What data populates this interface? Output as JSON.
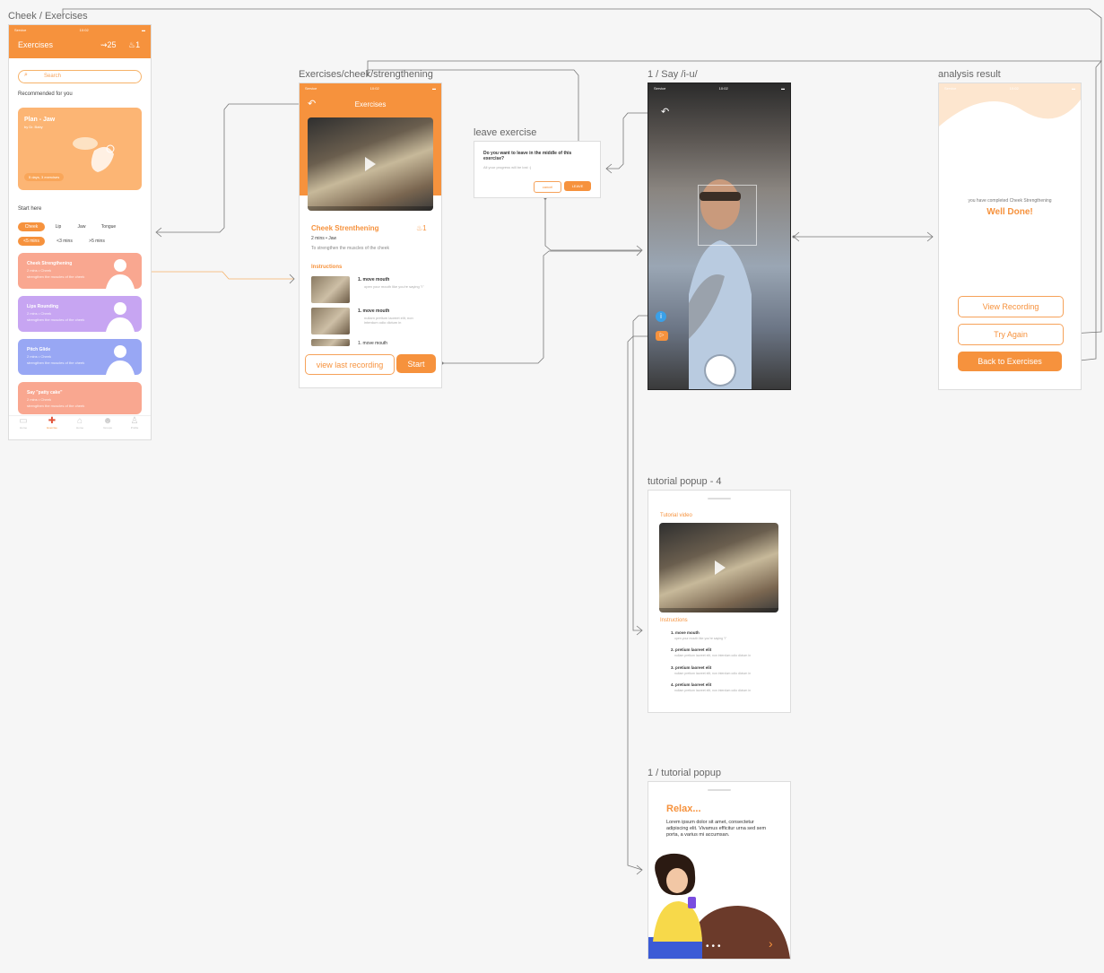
{
  "labels": {
    "exercises_list": "Cheek / Exercises",
    "exercise_detail": "Exercises/cheek/strengthening",
    "leave_exercise": "leave exercise",
    "say_screen": "1 / Say /i-u/",
    "analysis_result": "analysis result",
    "tutorial_popup_4": "tutorial popup - 4",
    "tutorial_popup_1": "1 / tutorial popup"
  },
  "list_screen": {
    "status_carrier": "Service",
    "status_time": "10:02",
    "title": "Exercises",
    "coins": "25",
    "streak": "1",
    "search_placeholder": "Search",
    "recommended_heading": "Recommended for you",
    "plan_title": "Plan - Jaw",
    "plan_author": "by Dr. Baby",
    "plan_badge": "5 days, 3 exercises",
    "start_heading": "Start here",
    "filters_row1": [
      "Cheek",
      "Lip",
      "Jaw",
      "Tongue"
    ],
    "filters_row2": [
      "<5 mins",
      "<3 mins",
      ">5 mins"
    ],
    "cards": [
      {
        "title": "Cheek Strengthening",
        "meta": "2 mins • Cheek",
        "desc": "strengthen the muscles of the cheek",
        "color": "#f9a790"
      },
      {
        "title": "Lips Rounding",
        "meta": "2 mins • Cheek",
        "desc": "strengthen the muscles of the cheek",
        "color": "#c7a5f2"
      },
      {
        "title": "Pitch Glide",
        "meta": "2 mins • Cheek",
        "desc": "strengthen the muscles of the cheek",
        "color": "#98a7f4"
      },
      {
        "title": "Say \"patty cake\"",
        "meta": "2 mins • Cheek",
        "desc": "strengthen the muscles of the cheek",
        "color": "#f9a790"
      }
    ],
    "nav": [
      "Home",
      "Exercise",
      "Home",
      "Groups",
      "Profile"
    ]
  },
  "detail_screen": {
    "header_title": "Exercises",
    "exercise_title": "Cheek Strenthening",
    "flames": "1",
    "meta": "2 mins • Jaw",
    "description": "To strengthen the muscles of the cheek",
    "instructions_heading": "Instructions",
    "steps": [
      {
        "title": "1. move mouth",
        "desc": "open your mouth like you're saying \"i\""
      },
      {
        "title": "1. move mouth",
        "desc": "nullam pretium laoreet elit, non interdum odio dictum in"
      },
      {
        "title": "1. move mouth",
        "desc": ""
      }
    ],
    "view_last_recording": "view last recording",
    "start": "Start"
  },
  "leave_dialog": {
    "question": "Do you want to leave in the middle of this exercise?",
    "hint": "All your progress will be lost :(",
    "cancel": "cancel",
    "leave": "LEAVE"
  },
  "result_screen": {
    "completed_text": "you have completed Cheek Strengthening",
    "well_done": "Well Done!",
    "view_recording": "View Recording",
    "try_again": "Try Again",
    "back_to_exercises": "Back to Exercises"
  },
  "tutorial4": {
    "video_heading": "Tutorial video",
    "instructions_heading": "Instructions",
    "steps": [
      {
        "title": "1. move mouth",
        "desc": "open your mouth like you're saying \"i\""
      },
      {
        "title": "2. pretium laoreet elit",
        "desc": "nullam pretium laoreet elit, non interdum odio dictum in"
      },
      {
        "title": "3. pretium laoreet elit",
        "desc": "nullam pretium laoreet elit, non interdum odio dictum in"
      },
      {
        "title": "4. pretium laoreet elit",
        "desc": "nullam pretium laoreet elit, non interdum odio dictum in"
      }
    ]
  },
  "tutorial1": {
    "heading": "Relax...",
    "body": "Lorem ipsum dolor sit amet, consectetur adipiscing elit. Vivamus efficitur urna sed sem porta, a varius mi accumsan.",
    "next": "›"
  },
  "colors": {
    "accent": "#f6923d",
    "accent_light": "#fcc08b"
  }
}
